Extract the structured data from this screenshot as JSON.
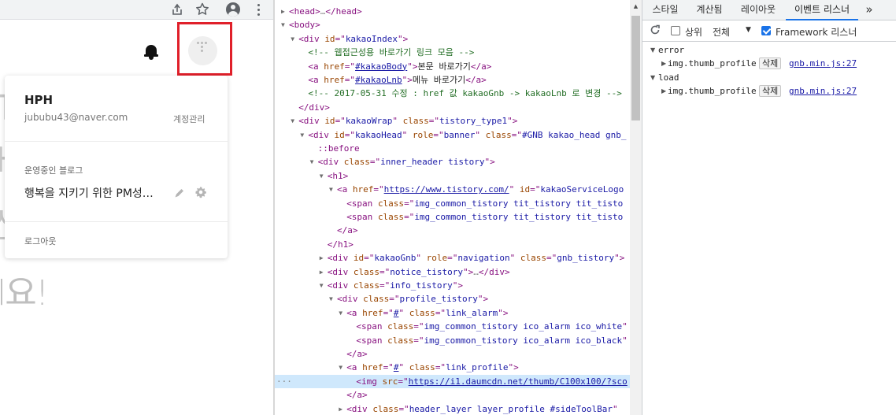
{
  "browser": {
    "icons": [
      "share-icon",
      "star-icon",
      "profile-icon",
      "more-icon"
    ]
  },
  "page": {
    "bg_glyphs": [
      "T",
      "H",
      "산"
    ],
    "bg_text": "l요!",
    "menu": {
      "nickname": "HPH",
      "email": "jububu43@naver.com",
      "account_manage": "계정관리",
      "section_title": "운영중인 블로그",
      "blog_name": "행복을 지키기 위한 PM성…",
      "logout": "로그아웃"
    },
    "highlight_color": "#e0202a"
  },
  "elements": {
    "lines": [
      {
        "indent": 1,
        "tri": "▶",
        "html": "<span class='tag'>&lt;head&gt;</span><span class='dots'>…</span><span class='tag'>&lt;/head&gt;</span>"
      },
      {
        "indent": 1,
        "tri": "▼",
        "html": "<span class='tag'>&lt;body&gt;</span>"
      },
      {
        "indent": 2,
        "tri": "▼",
        "html": "<span class='tag'>&lt;div </span><span class='an'>id</span><span class='tag'>=\"</span><span class='av-str'>kakaoIndex</span><span class='tag'>\"&gt;</span>"
      },
      {
        "indent": 3,
        "tri": "",
        "html": "<span class='cm'>&lt;!-- 웹접근성용 바로가기 링크 모음 --&gt;</span>"
      },
      {
        "indent": 3,
        "tri": "",
        "html": "<span class='tag'>&lt;a </span><span class='an'>href</span><span class='tag'>=\"</span><span class='av-link'>#kakaoBody</span><span class='tag'>\"&gt;</span><span class='txt'>본문 바로가기</span><span class='tag'>&lt;/a&gt;</span>"
      },
      {
        "indent": 3,
        "tri": "",
        "html": "<span class='tag'>&lt;a </span><span class='an'>href</span><span class='tag'>=\"</span><span class='av-link'>#kakaoLnb</span><span class='tag'>\"&gt;</span><span class='txt'>메뉴 바로가기</span><span class='tag'>&lt;/a&gt;</span>"
      },
      {
        "indent": 3,
        "tri": "",
        "html": "<span class='cm'>&lt;!-- 2017-05-31 수정 : href 값 kakaoGnb -&gt; kakaoLnb 로 변경 --&gt;</span>"
      },
      {
        "indent": 2,
        "tri": "",
        "html": "<span class='tag'>&lt;/div&gt;</span>"
      },
      {
        "indent": 2,
        "tri": "▼",
        "html": "<span class='tag'>&lt;div </span><span class='an'>id</span><span class='tag'>=\"</span><span class='av-str'>kakaoWrap</span><span class='tag'>\" </span><span class='an'>class</span><span class='tag'>=\"</span><span class='av-str'>tistory_type1</span><span class='tag'>\"&gt;</span>"
      },
      {
        "indent": 3,
        "tri": "▼",
        "html": "<span class='tag'>&lt;div </span><span class='an'>id</span><span class='tag'>=\"</span><span class='av-str'>kakaoHead</span><span class='tag'>\" </span><span class='an'>role</span><span class='tag'>=\"</span><span class='av-str'>banner</span><span class='tag'>\" </span><span class='an'>class</span><span class='tag'>=\"</span><span class='av-str'>#GNB kakao_head gnb_</span>"
      },
      {
        "indent": 4,
        "tri": "",
        "html": "<span class='pseudo'>::before</span>"
      },
      {
        "indent": 4,
        "tri": "▼",
        "html": "<span class='tag'>&lt;div </span><span class='an'>class</span><span class='tag'>=\"</span><span class='av-str'>inner_header tistory</span><span class='tag'>\"&gt;</span>"
      },
      {
        "indent": 5,
        "tri": "▼",
        "html": "<span class='tag'>&lt;h1&gt;</span>"
      },
      {
        "indent": 6,
        "tri": "▼",
        "html": "<span class='tag'>&lt;a </span><span class='an'>href</span><span class='tag'>=\"</span><span class='av-link'>https://www.tistory.com/</span><span class='tag'>\" </span><span class='an'>id</span><span class='tag'>=\"</span><span class='av-str'>kakaoServiceLogo</span>"
      },
      {
        "indent": 7,
        "tri": "",
        "html": "<span class='tag'>&lt;span </span><span class='an'>class</span><span class='tag'>=\"</span><span class='av-str'>img_common_tistory tit_tistory tit_tisto</span>"
      },
      {
        "indent": 7,
        "tri": "",
        "html": "<span class='tag'>&lt;span </span><span class='an'>class</span><span class='tag'>=\"</span><span class='av-str'>img_common_tistory tit_tistory tit_tisto</span>"
      },
      {
        "indent": 6,
        "tri": "",
        "html": "<span class='tag'>&lt;/a&gt;</span>"
      },
      {
        "indent": 5,
        "tri": "",
        "html": "<span class='tag'>&lt;/h1&gt;</span>"
      },
      {
        "indent": 5,
        "tri": "▶",
        "html": "<span class='tag'>&lt;div </span><span class='an'>id</span><span class='tag'>=\"</span><span class='av-str'>kakaoGnb</span><span class='tag'>\" </span><span class='an'>role</span><span class='tag'>=\"</span><span class='av-str'>navigation</span><span class='tag'>\" </span><span class='an'>class</span><span class='tag'>=\"</span><span class='av-str'>gnb_tistory</span><span class='tag'>\"&gt;</span>"
      },
      {
        "indent": 5,
        "tri": "▶",
        "html": "<span class='tag'>&lt;div </span><span class='an'>class</span><span class='tag'>=\"</span><span class='av-str'>notice_tistory</span><span class='tag'>\"&gt;</span><span class='dots'>…</span><span class='tag'>&lt;/div&gt;</span>"
      },
      {
        "indent": 5,
        "tri": "▼",
        "html": "<span class='tag'>&lt;div </span><span class='an'>class</span><span class='tag'>=\"</span><span class='av-str'>info_tistory</span><span class='tag'>\"&gt;</span>"
      },
      {
        "indent": 6,
        "tri": "▼",
        "html": "<span class='tag'>&lt;div </span><span class='an'>class</span><span class='tag'>=\"</span><span class='av-str'>profile_tistory</span><span class='tag'>\"&gt;</span>"
      },
      {
        "indent": 7,
        "tri": "▼",
        "html": "<span class='tag'>&lt;a </span><span class='an'>href</span><span class='tag'>=\"</span><span class='av-link'>#</span><span class='tag'>\" </span><span class='an'>class</span><span class='tag'>=\"</span><span class='av-str'>link_alarm</span><span class='tag'>\"&gt;</span>"
      },
      {
        "indent": 8,
        "tri": "",
        "html": "<span class='tag'>&lt;span </span><span class='an'>class</span><span class='tag'>=\"</span><span class='av-str'>img_common_tistory ico_alarm ico_white</span><span class='tag'>\"</span>"
      },
      {
        "indent": 8,
        "tri": "",
        "html": "<span class='tag'>&lt;span </span><span class='an'>class</span><span class='tag'>=\"</span><span class='av-str'>img_common_tistory ico_alarm ico_black</span><span class='tag'>\"</span>"
      },
      {
        "indent": 7,
        "tri": "",
        "html": "<span class='tag'>&lt;/a&gt;</span>"
      },
      {
        "indent": 7,
        "tri": "▼",
        "html": "<span class='tag'>&lt;a </span><span class='an'>href</span><span class='tag'>=\"</span><span class='av-link'>#</span><span class='tag'>\" </span><span class='an'>class</span><span class='tag'>=\"</span><span class='av-str'>link_profile</span><span class='tag'>\"&gt;</span>"
      },
      {
        "indent": 8,
        "tri": "",
        "sel": true,
        "html": "<span class='tag'>&lt;img </span><span class='an'>src</span><span class='tag'>=\"</span><span class='av-link'>https://i1.daumcdn.net/thumb/C100x100/?sco</span>"
      },
      {
        "indent": 7,
        "tri": "",
        "html": "<span class='tag'>&lt;/a&gt;</span>"
      },
      {
        "indent": 7,
        "tri": "▶",
        "html": "<span class='tag'>&lt;div </span><span class='an'>class</span><span class='tag'>=\"</span><span class='av-str'>header_layer layer_profile #sideToolBar</span><span class='tag'>\"</span>"
      }
    ],
    "selected_marker": "···"
  },
  "sidebar": {
    "tabs": [
      "스타일",
      "계산됨",
      "레이아웃",
      "이벤트 리스너",
      "»"
    ],
    "active_tab": 3,
    "toolbar": {
      "ancestors_label": "상위",
      "scope_label": "전체",
      "framework_label": "Framework 리스너",
      "ancestors_checked": false,
      "framework_checked": true
    },
    "events": [
      {
        "name": "error",
        "listener": "img.thumb_profile",
        "remove": "삭제",
        "source": "gnb.min.js:27"
      },
      {
        "name": "load",
        "listener": "img.thumb_profile",
        "remove": "삭제",
        "source": "gnb.min.js:27"
      }
    ]
  }
}
